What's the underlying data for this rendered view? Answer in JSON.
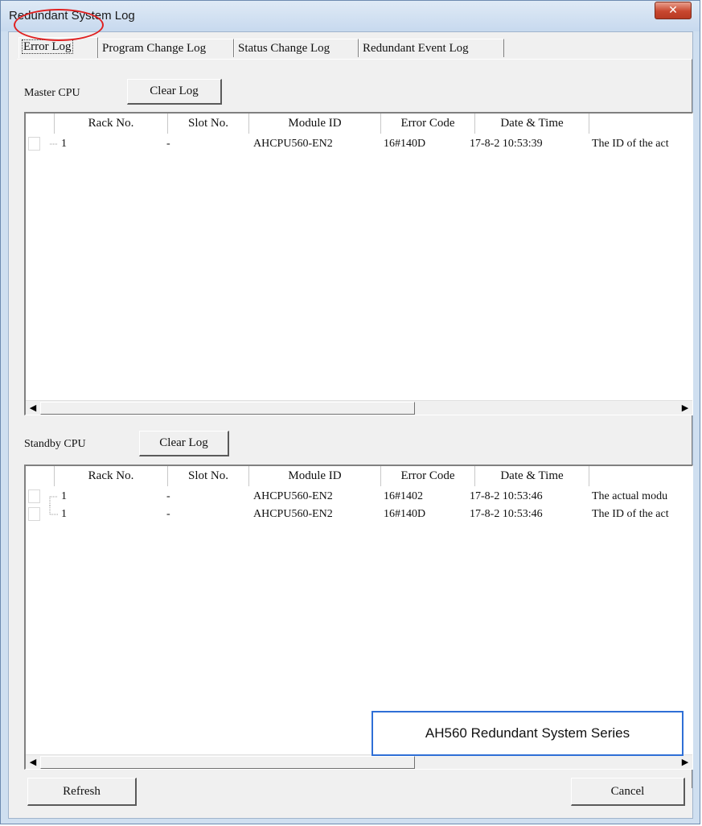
{
  "window": {
    "title": "Redundant System Log"
  },
  "tabs": [
    "Error Log",
    "Program Change Log",
    "Status Change Log",
    "Redundant Event Log"
  ],
  "columns": [
    "Rack No.",
    "Slot No.",
    "Module ID",
    "Error Code",
    "Date & Time",
    ""
  ],
  "master": {
    "label": "Master CPU",
    "clear_label": "Clear Log",
    "rows": [
      [
        "1",
        "-",
        "AHCPU560-EN2",
        "16#140D",
        "17-8-2  10:53:39",
        "The ID of the act"
      ]
    ]
  },
  "standby": {
    "label": "Standby CPU",
    "clear_label": "Clear Log",
    "rows": [
      [
        "1",
        "-",
        "AHCPU560-EN2",
        "16#1402",
        "17-8-2  10:53:46",
        "The actual modu"
      ],
      [
        "1",
        "-",
        "AHCPU560-EN2",
        "16#140D",
        "17-8-2  10:53:46",
        "The ID of the act"
      ]
    ]
  },
  "footer": {
    "refresh_label": "Refresh",
    "cancel_label": "Cancel"
  },
  "annotation": "AH560 Redundant System Series",
  "icons": {
    "close": "close-icon",
    "scroll_left": "scroll-left-icon",
    "scroll_right": "scroll-right-icon"
  },
  "colors": {
    "highlight_circle": "#e02020",
    "annotation_border": "#2f6fd6"
  }
}
